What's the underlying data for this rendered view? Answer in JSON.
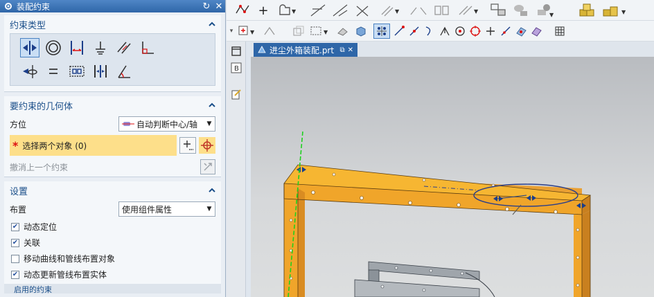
{
  "dialog": {
    "title": "装配约束",
    "sections": {
      "constraint_type": {
        "title": "约束类型"
      },
      "geometry": {
        "title": "要约束的几何体",
        "orientation_label": "方位",
        "orientation_value": "自动判断中心/轴",
        "select_objects": "选择两个对象 (0)",
        "undo_last": "撤消上一个约束"
      },
      "settings": {
        "title": "设置",
        "layout_label": "布置",
        "layout_value": "使用组件属性",
        "checkboxes": [
          {
            "label": "动态定位",
            "checked": true
          },
          {
            "label": "关联",
            "checked": true
          },
          {
            "label": "移动曲线和管线布置对象",
            "checked": false
          },
          {
            "label": "动态更新管线布置实体",
            "checked": true
          }
        ],
        "next_section_partial": "启用的约束"
      }
    }
  },
  "graphics": {
    "tab_label": "进尘外箱装配.prt"
  },
  "colors": {
    "accent": "#2e66a8",
    "frame": "#f0a52a",
    "highlight": "#fddf8a"
  }
}
